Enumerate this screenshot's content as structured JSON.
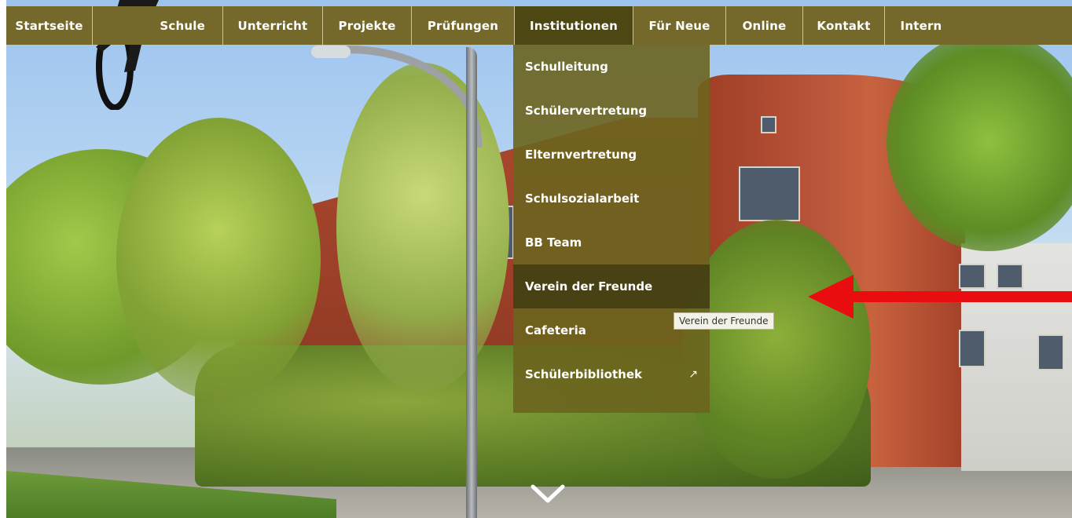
{
  "nav": {
    "items": [
      {
        "label": "Startseite"
      },
      {
        "label": "Schule"
      },
      {
        "label": "Unterricht"
      },
      {
        "label": "Projekte"
      },
      {
        "label": "Prüfungen"
      },
      {
        "label": "Institutionen"
      },
      {
        "label": "Für Neue"
      },
      {
        "label": "Online"
      },
      {
        "label": "Kontakt"
      },
      {
        "label": "Intern"
      }
    ],
    "active": "Institutionen"
  },
  "dropdown": {
    "items": [
      {
        "label": "Schulleitung"
      },
      {
        "label": "Schülervertretung"
      },
      {
        "label": "Elternvertretung"
      },
      {
        "label": "Schulsozialarbeit"
      },
      {
        "label": "BB Team"
      },
      {
        "label": "Verein der Freunde"
      },
      {
        "label": "Cafeteria"
      },
      {
        "label": "Schülerbibliothek",
        "external_icon": "↗"
      }
    ],
    "hovered": "Verein der Freunde"
  },
  "tooltip": {
    "text": "Verein der Freunde"
  },
  "annotation": {
    "color": "#ea0d10",
    "icon": "left-arrow-icon"
  },
  "scroll_indicator": {
    "icon": "chevron-down-icon"
  },
  "colors": {
    "nav_bg": "#74692a",
    "nav_active": "#4d4713",
    "dropdown_bg": "#6c641e"
  }
}
